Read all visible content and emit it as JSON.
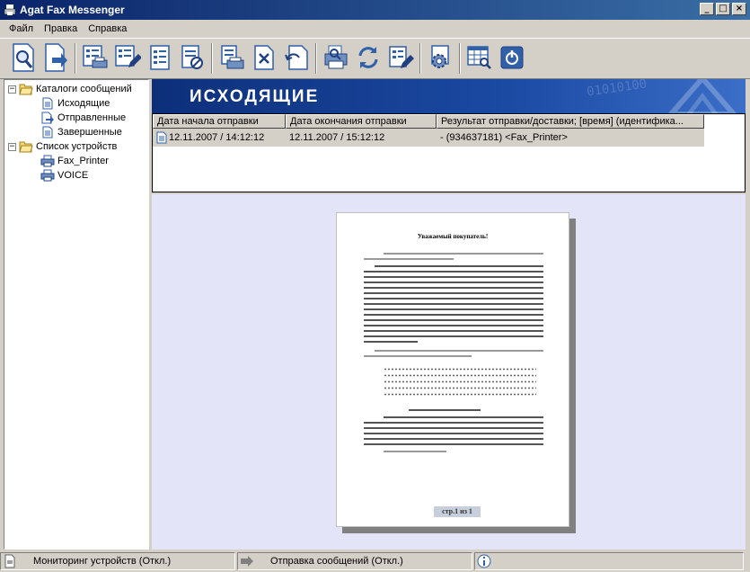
{
  "window": {
    "title": "Agat Fax Messenger",
    "minimize": "_",
    "maximize": "□",
    "close": "×"
  },
  "menu": [
    {
      "label": "Файл"
    },
    {
      "label": "Правка"
    },
    {
      "label": "Справка"
    }
  ],
  "tree": {
    "catalogs": {
      "label": "Каталоги сообщений",
      "expander": "−"
    },
    "outgoing": {
      "label": "Исходящие"
    },
    "sent": {
      "label": "Отправленные"
    },
    "completed": {
      "label": "Завершенные"
    },
    "devices": {
      "label": "Список устройств",
      "expander": "−"
    },
    "fax_printer": {
      "label": "Fax_Printer"
    },
    "voice": {
      "label": "VOICE"
    }
  },
  "header": {
    "title": "ИСХОДЯЩИЕ",
    "decor": "01010100"
  },
  "table": {
    "columns": [
      "Дата начала отправки",
      "Дата окончания отправки",
      "Результат отправки/доставки; [время] (идентифика..."
    ],
    "rows": [
      [
        "12.11.2007 / 14:12:12",
        "12.11.2007 / 15:12:12",
        "- (934637181) <Fax_Printer>"
      ]
    ]
  },
  "preview": {
    "title": "Уважаемый покупатель!",
    "page_label": "стр.1 из 1"
  },
  "status": {
    "monitoring": "Мониторинг устройств (Откл.)",
    "sending": "Отправка сообщений (Откл.)"
  },
  "colors": {
    "title_bar": "#0a246a",
    "header_bg": "#1b4aa3",
    "preview_bg": "#e4e4f8",
    "toolbar_icon": "#3060a8"
  }
}
